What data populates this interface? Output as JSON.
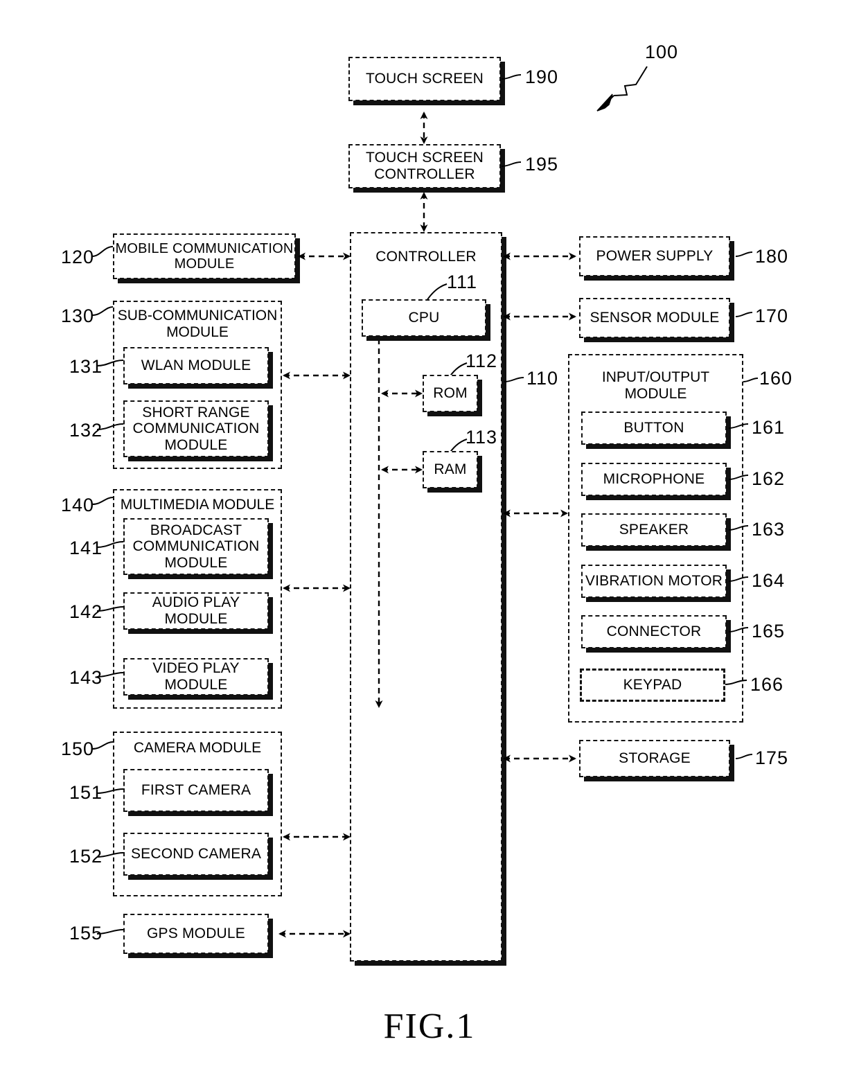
{
  "figure": {
    "caption": "FIG.1",
    "device_ref": "100"
  },
  "blocks": {
    "touch_screen": {
      "label": "TOUCH SCREEN",
      "ref": "190"
    },
    "touch_screen_controller": {
      "label": "TOUCH SCREEN\nCONTROLLER",
      "ref": "195"
    },
    "controller": {
      "label": "CONTROLLER",
      "ref": "110"
    },
    "cpu": {
      "label": "CPU",
      "ref": "111"
    },
    "rom": {
      "label": "ROM",
      "ref": "112"
    },
    "ram": {
      "label": "RAM",
      "ref": "113"
    },
    "mobile_communication": {
      "label": "MOBILE COMMUNICATION\nMODULE",
      "ref": "120"
    },
    "sub_communication": {
      "label": "SUB-COMMUNICATION\nMODULE",
      "ref": "130"
    },
    "wlan": {
      "label": "WLAN MODULE",
      "ref": "131"
    },
    "short_range": {
      "label": "SHORT RANGE\nCOMMUNICATION\nMODULE",
      "ref": "132"
    },
    "multimedia": {
      "label": "MULTIMEDIA MODULE",
      "ref": "140"
    },
    "broadcast": {
      "label": "BROADCAST\nCOMMUNICATION\nMODULE",
      "ref": "141"
    },
    "audio_play": {
      "label": "AUDIO PLAY MODULE",
      "ref": "142"
    },
    "video_play": {
      "label": "VIDEO PLAY MODULE",
      "ref": "143"
    },
    "camera": {
      "label": "CAMERA MODULE",
      "ref": "150"
    },
    "first_camera": {
      "label": "FIRST CAMERA",
      "ref": "151"
    },
    "second_camera": {
      "label": "SECOND CAMERA",
      "ref": "152"
    },
    "gps": {
      "label": "GPS MODULE",
      "ref": "155"
    },
    "power_supply": {
      "label": "POWER SUPPLY",
      "ref": "180"
    },
    "sensor_module": {
      "label": "SENSOR MODULE",
      "ref": "170"
    },
    "input_output": {
      "label": "INPUT/OUTPUT MODULE",
      "ref": "160"
    },
    "button": {
      "label": "BUTTON",
      "ref": "161"
    },
    "microphone": {
      "label": "MICROPHONE",
      "ref": "162"
    },
    "speaker": {
      "label": "SPEAKER",
      "ref": "163"
    },
    "vibration_motor": {
      "label": "VIBRATION MOTOR",
      "ref": "164"
    },
    "connector": {
      "label": "CONNECTOR",
      "ref": "165"
    },
    "keypad": {
      "label": "KEYPAD",
      "ref": "166"
    },
    "storage": {
      "label": "STORAGE",
      "ref": "175"
    }
  }
}
